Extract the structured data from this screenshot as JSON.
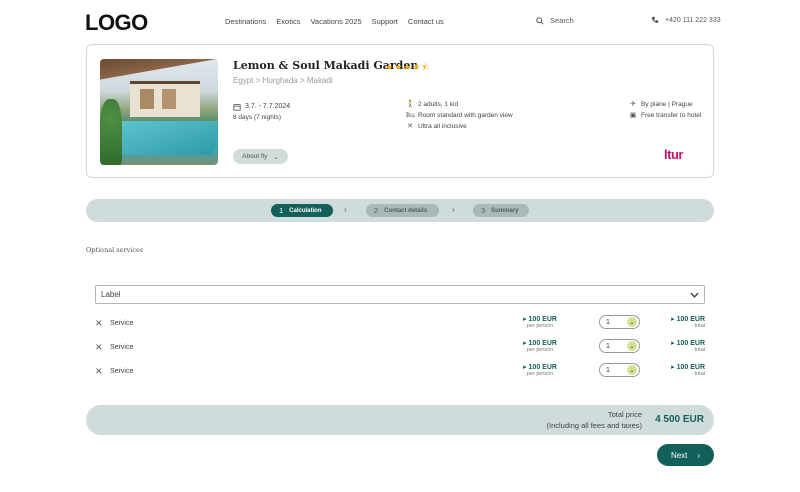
{
  "header": {
    "logo": "LOGO",
    "nav": [
      "Destinations",
      "Exotics",
      "Vacations 2025",
      "Support",
      "Contact us"
    ],
    "search_label": "Search",
    "phone": "+420 111 222 333"
  },
  "hotel": {
    "name": "Lemon & Soul Makadi Garden",
    "stars": "★★★★⯪",
    "rating": 4.5,
    "breadcrumb": "Egypt  >  Hurghada  >  Makadi",
    "dates": "3.7. - 7.7.2024",
    "duration": "8 days (7 nights)",
    "guests": "2 adults, 1 kid",
    "room": "Room standard with garden view",
    "board": "Ultra all inclusive",
    "transport": "By plane  |  Prague",
    "transfer": "Free transfer to hotel",
    "about_label": "About fly",
    "brand": "ltur"
  },
  "steps": [
    {
      "num": "1",
      "label": "Calculation"
    },
    {
      "num": "2",
      "label": "Contact details"
    },
    {
      "num": "3",
      "label": "Summary"
    }
  ],
  "optional_title": "Optional services",
  "select_label": "Label",
  "services": [
    {
      "name": "Service",
      "price": "100 EUR",
      "per": "per person",
      "qty": "1",
      "total": "100 EUR",
      "total_sub": "total"
    },
    {
      "name": "Service",
      "price": "100 EUR",
      "per": "per person",
      "qty": "1",
      "total": "100 EUR",
      "total_sub": "total"
    },
    {
      "name": "Service",
      "price": "100 EUR",
      "per": "per person",
      "qty": "1",
      "total": "100 EUR",
      "total_sub": "total"
    }
  ],
  "total": {
    "label1": "Total price",
    "label2": "(Including all fees and taxes)",
    "value": "4 500 EUR"
  },
  "next_label": "Next",
  "colors": {
    "primary": "#135f5a",
    "light": "#cfdcdb",
    "brand": "#c4126a",
    "star": "#f2b01e"
  }
}
